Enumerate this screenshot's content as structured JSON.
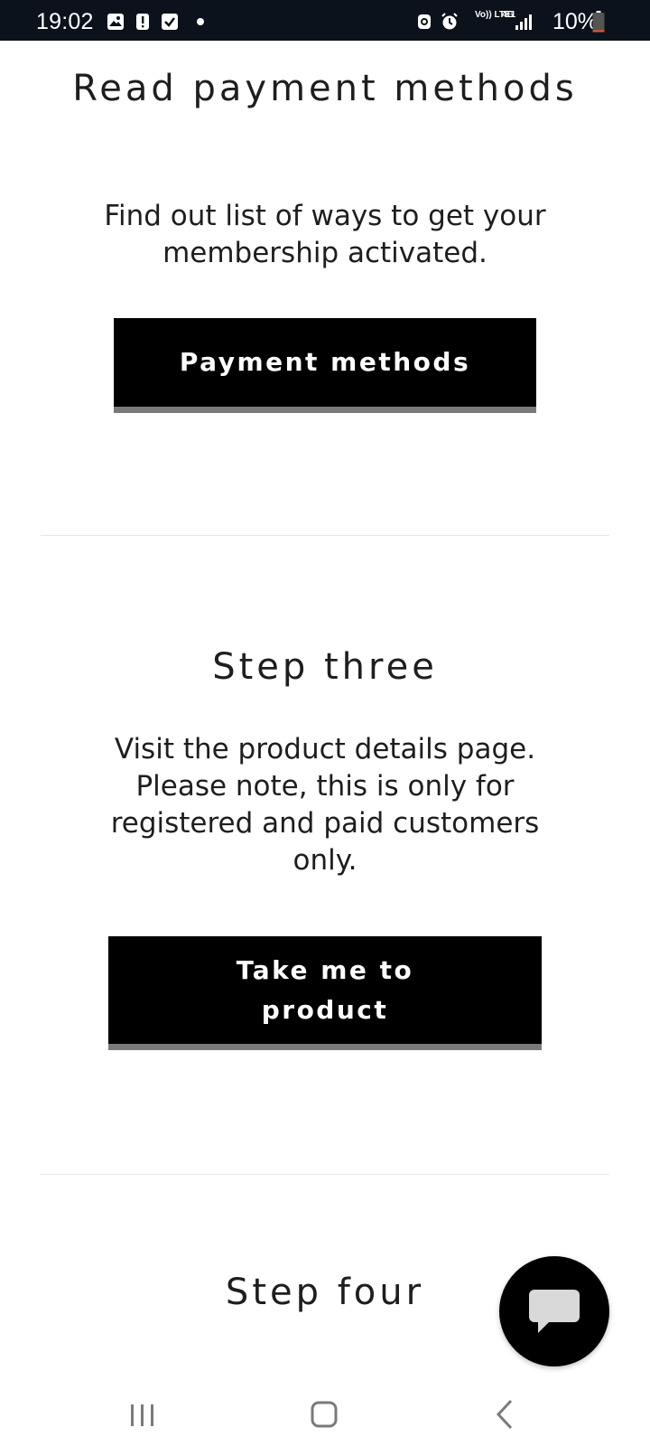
{
  "status_bar": {
    "time": "19:02",
    "volte_label": "Vo)) LTE1",
    "network_label": "4G",
    "battery_percent": "10%",
    "icons": [
      "gallery-icon",
      "alert-icon",
      "checkbox-icon",
      "dot-icon",
      "android-icon",
      "alarm-icon",
      "signal-icon",
      "battery-icon"
    ],
    "battery_level": 0.1,
    "battery_color": "#e0583a"
  },
  "sections": [
    {
      "heading": "Read payment methods",
      "description": "Find out list of ways to get your membership activated.",
      "button_label": "Payment methods"
    },
    {
      "heading": "Step three",
      "description": "Visit the product details page. Please note, this is only for registered and paid customers only.",
      "button_label": "Take me to product"
    },
    {
      "heading": "Step four"
    }
  ],
  "chat": {
    "icon": "chat-bubble-icon"
  },
  "nav_bar": {
    "icons": [
      "recent-apps-icon",
      "home-icon",
      "back-icon"
    ]
  },
  "colors": {
    "button_bg": "#000000",
    "button_border": "#7a7a7a",
    "status_bar_bg": "#0c121b"
  }
}
